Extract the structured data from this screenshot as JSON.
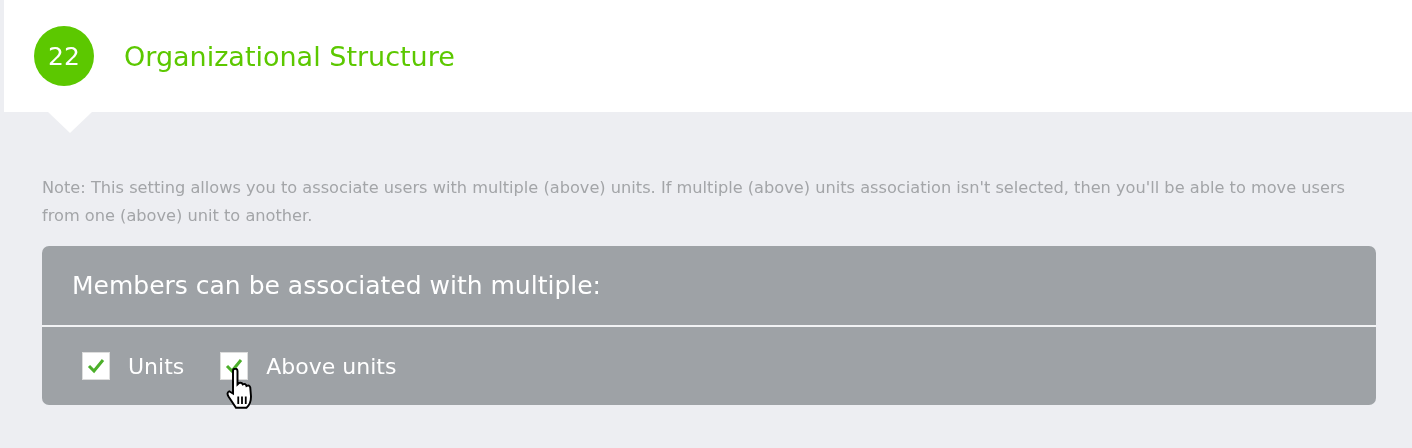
{
  "section": {
    "number": "22",
    "title": "Organizational Structure"
  },
  "note": "Note: This setting allows you to associate users with multiple (above) units. If multiple (above) units association isn't selected, then you'll be able to move users from one (above) unit to another.",
  "panel": {
    "heading": "Members can be associated with multiple:",
    "options": [
      {
        "label": "Units",
        "checked": true
      },
      {
        "label": "Above units",
        "checked": true
      }
    ]
  }
}
